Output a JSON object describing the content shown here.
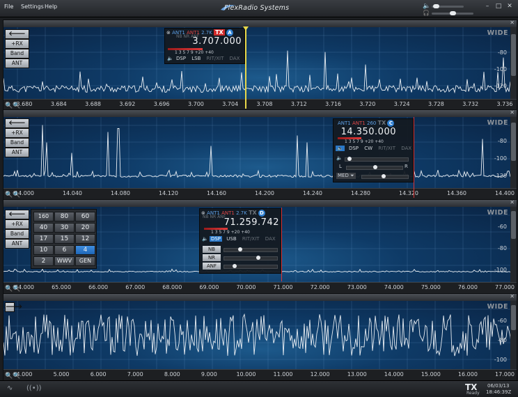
{
  "menu": {
    "file": "File",
    "settings": "Settings",
    "help": "Help"
  },
  "brand": "FlexRadio Systems",
  "window": {
    "minimize": "–",
    "maximize": "□",
    "close": "✕"
  },
  "side": {
    "back": "🡐",
    "rx": "+RX",
    "band": "Band",
    "ant": "ANT"
  },
  "wide": "WIDE",
  "panadapters": [
    {
      "freq_labels": [
        "3.680",
        "3.684",
        "3.688",
        "3.692",
        "3.696",
        "3.700",
        "3.704",
        "3.708",
        "3.712",
        "3.716",
        "3.720",
        "3.724",
        "3.728",
        "3.732",
        "3.736"
      ],
      "db_labels": [
        "-80",
        "-100",
        "-120"
      ]
    },
    {
      "freq_labels": [
        "14.000",
        "14.040",
        "14.080",
        "14.120",
        "14.160",
        "14.200",
        "14.240",
        "14.280",
        "14.320",
        "14.360",
        "14.400"
      ],
      "db_labels": [
        "-80",
        "-100",
        "-120"
      ]
    },
    {
      "freq_labels": [
        "64.000",
        "65.000",
        "66.000",
        "67.000",
        "68.000",
        "69.000",
        "70.000",
        "71.000",
        "72.000",
        "73.000",
        "74.000",
        "75.000",
        "76.000",
        "77.000"
      ],
      "db_labels": [
        "-60",
        "-80",
        "-100"
      ]
    },
    {
      "freq_labels": [
        "4.000",
        "5.000",
        "6.000",
        "7.000",
        "8.000",
        "9.000",
        "10.000",
        "11.000",
        "12.000",
        "13.000",
        "14.000",
        "15.000",
        "16.000",
        "17.000"
      ],
      "db_labels": [
        "-60",
        "-80",
        "-100"
      ]
    }
  ],
  "slice_a": {
    "ant_rx": "ANT1",
    "ant_tx": "ANT1",
    "filter": "2.7K",
    "tx": "TX",
    "letter": "A",
    "freq": "3.707.000",
    "nb": "NB NR ANF",
    "smeter": "1 3 5 7 9 +20 +40",
    "buttons": [
      "DSP",
      "LSB",
      "RIT/XIT",
      "DAX"
    ]
  },
  "slice_c": {
    "ant_rx": "ANT1",
    "ant_tx": "ANT1",
    "filter": "260",
    "tx": "TX",
    "letter": "C",
    "freq": "14.350.000",
    "smeter": "1 3 5 7 9 +20 +40",
    "buttons": [
      "DSP",
      "CW",
      "RIT/XIT",
      "DAX"
    ],
    "pan_l": "L",
    "pan_r": "R",
    "agc": "MED"
  },
  "slice_d": {
    "ant_rx": "ANT1",
    "ant_tx": "ANT1",
    "filter": "2.7K",
    "tx": "TX",
    "letter": "D",
    "freq": "71.259.742",
    "nb": "NB NR ANF",
    "smeter": "1 3 5 7 9 +20 +40",
    "buttons": [
      "DSP",
      "USB",
      "RIT/XIT",
      "DAX"
    ],
    "dsp": [
      "NB",
      "NR",
      "ANF"
    ]
  },
  "band_keys": [
    "160",
    "80",
    "60",
    "40",
    "30",
    "20",
    "17",
    "15",
    "12",
    "10",
    "6",
    "4",
    "2",
    "WWV",
    "GEN"
  ],
  "band_selected": "4",
  "status": {
    "tx": "TX",
    "ready": "Ready",
    "date": "06/03/13",
    "time": "18:46:39Z"
  }
}
